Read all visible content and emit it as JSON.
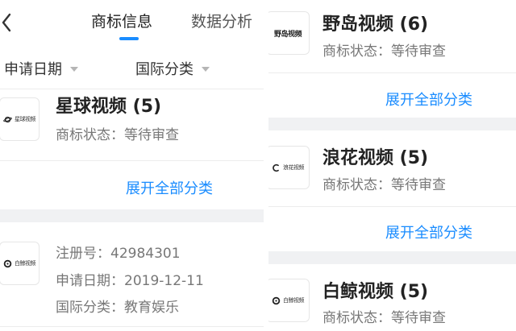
{
  "left": {
    "tabs": [
      {
        "label": "商标信息",
        "active": true
      },
      {
        "label": "数据分析",
        "active": false
      }
    ],
    "filters": {
      "date_label": "申请日期",
      "class_label": "国际分类"
    },
    "card1": {
      "logo_text": "星球视频",
      "name": "星球视频 (5)",
      "status": "商标状态：等待审查",
      "expand_label": "展开全部分类"
    },
    "card2": {
      "logo_text": "白鲸视频",
      "reg_no": "注册号：42984301",
      "apply_date": "申请日期：2019-12-11",
      "intl_class": "国际分类：教育娱乐"
    }
  },
  "right": {
    "cards": [
      {
        "logo_text": "野岛视频",
        "name": "野岛视频 (6)",
        "status": "商标状态：等待审查",
        "expand_label": "展开全部分类"
      },
      {
        "logo_text": "浪花视频",
        "name": "浪花视频 (5)",
        "status": "商标状态：等待审查",
        "expand_label": "展开全部分类"
      },
      {
        "logo_text": "白鲸视频",
        "name": "白鲸视频 (5)",
        "status": "商标状态：等待审查"
      }
    ]
  },
  "colors": {
    "accent": "#1a8cff",
    "band": "#f0f1f3",
    "muted_text": "#777777"
  }
}
